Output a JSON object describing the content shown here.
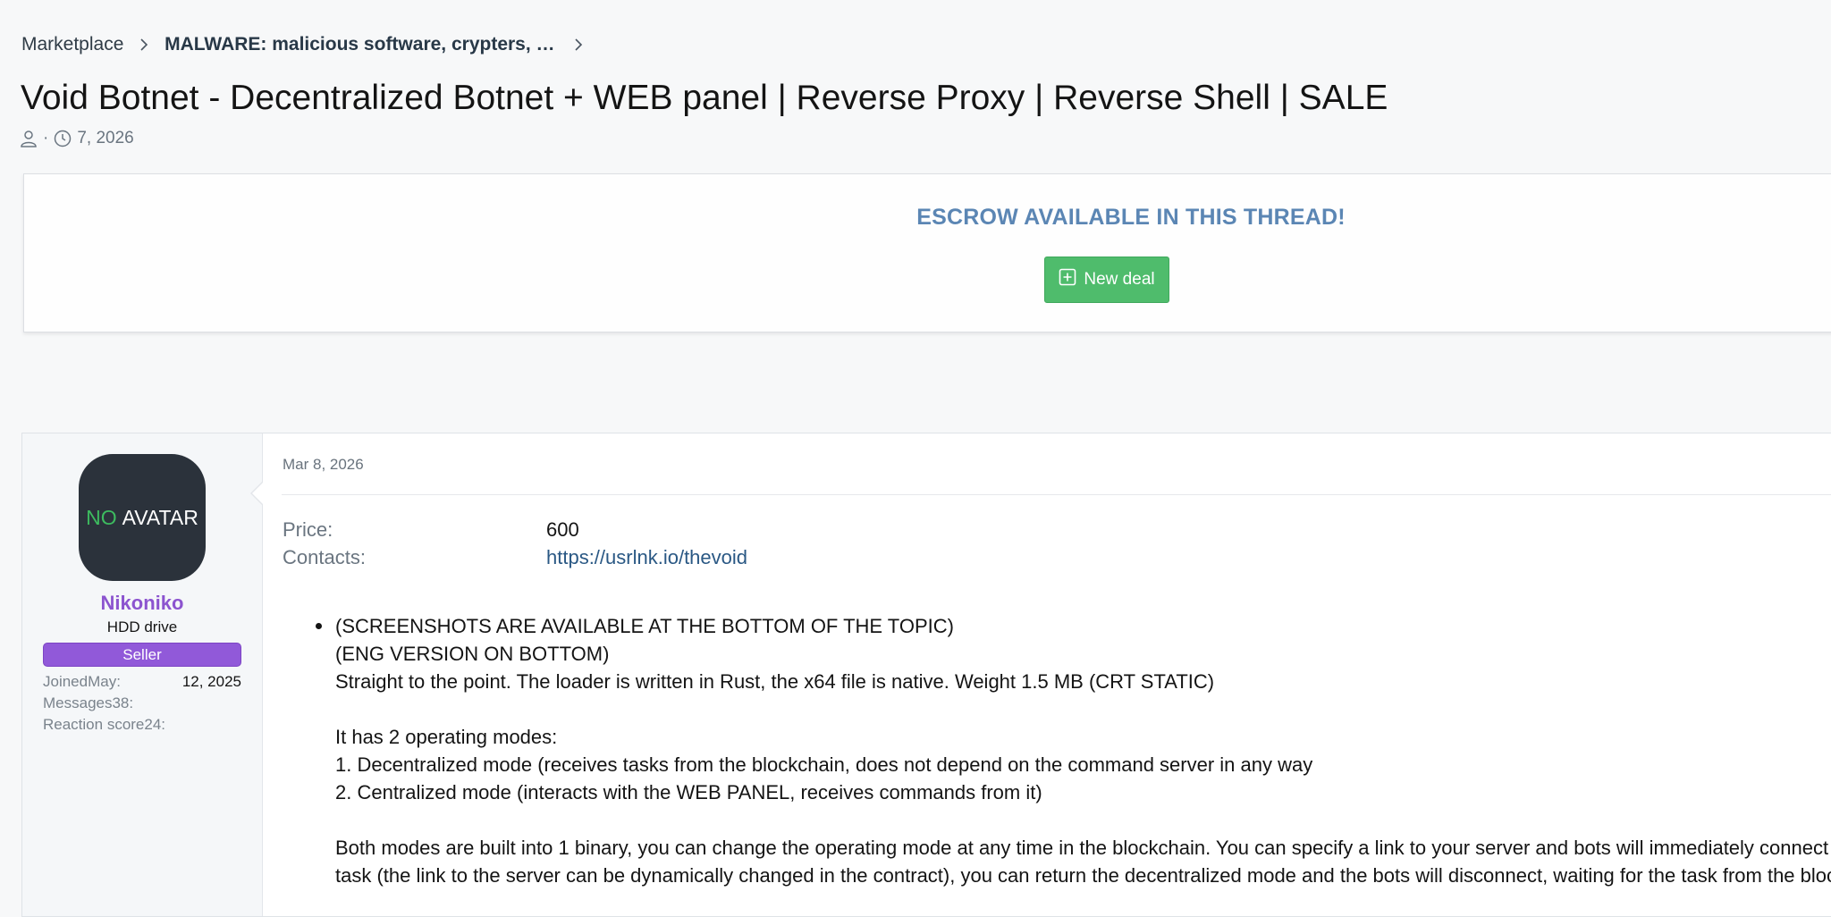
{
  "breadcrumb": {
    "items": [
      "Marketplace",
      "MALWARE: malicious software, crypters, i…"
    ]
  },
  "thread": {
    "title": "Void Botnet - Decentralized Botnet + WEB panel | Reverse Proxy | Reverse Shell | SALE",
    "meta_separator": "·",
    "date": "7, 2026"
  },
  "escrow": {
    "title": "ESCROW AVAILABLE IN THIS THREAD!",
    "button_label": "New deal",
    "button_color": "#4fbc6c",
    "title_color": "#5b86b4"
  },
  "user": {
    "avatar_no": "NO",
    "avatar_text": "AVATAR",
    "name": "Nikoniko",
    "name_color": "#8c54cf",
    "rank": "HDD drive",
    "badge": "Seller",
    "joined_label": "JoinedMay:",
    "joined_value": "12, 2025",
    "messages_label": "Messages38:",
    "reaction_label": "Reaction score24:"
  },
  "post": {
    "date": "Mar 8, 2026",
    "fields": {
      "price_label": "Price:",
      "price_value": "600",
      "contacts_label": "Contacts:",
      "contacts_value": "https://usrlnk.io/thevoid"
    },
    "body_lines": [
      "(SCREENSHOTS ARE AVAILABLE AT THE BOTTOM OF THE TOPIC)",
      "(ENG VERSION ON BOTTOM)",
      "Straight to the point. The loader is written in Rust, the x64 file is native. Weight 1.5 MB (CRT STATIC)",
      "",
      "It has 2 operating modes:",
      "1. Decentralized mode (receives tasks from the blockchain, does not depend on the command server in any way",
      "2. Centralized mode (interacts with the WEB PANEL, receives commands from it)",
      "",
      "Both modes are built into 1 binary, you can change the operating mode at any time in the blockchain. You can specify a link to your server and bots will immediately connect",
      "task (the link to the server can be dynamically changed in the contract), you can return the decentralized mode and the bots will disconnect, waiting for the task from the blockchain"
    ]
  }
}
